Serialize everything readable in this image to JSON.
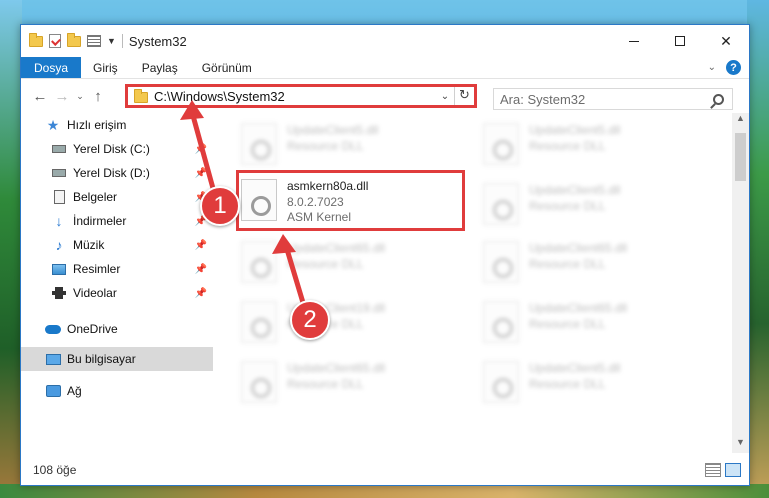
{
  "window": {
    "title": "System32",
    "controls": {
      "minimize": "—",
      "maximize": "",
      "close": "✕"
    }
  },
  "ribbon": {
    "tabs": [
      "Dosya",
      "Giriş",
      "Paylaş",
      "Görünüm"
    ],
    "help": "?"
  },
  "nav": {
    "back": "←",
    "forward": "→",
    "recent": "⌄",
    "up": "↑",
    "address": "C:\\Windows\\System32",
    "dropdown": "⌄",
    "refresh": "↻",
    "search_placeholder": "Ara: System32"
  },
  "sidebar": {
    "items": [
      {
        "label": "Hızlı erişim",
        "icon": "star-icon",
        "pinned": false
      },
      {
        "label": "Yerel Disk (C:)",
        "icon": "disk-icon",
        "pinned": true
      },
      {
        "label": "Yerel Disk (D:)",
        "icon": "disk-icon",
        "pinned": true
      },
      {
        "label": "Belgeler",
        "icon": "document-icon",
        "pinned": true
      },
      {
        "label": "İndirmeler",
        "icon": "download-icon",
        "pinned": true
      },
      {
        "label": "Müzik",
        "icon": "music-icon",
        "pinned": true
      },
      {
        "label": "Resimler",
        "icon": "pictures-icon",
        "pinned": true
      },
      {
        "label": "Videolar",
        "icon": "videos-icon",
        "pinned": true
      },
      {
        "label": "OneDrive",
        "icon": "cloud-icon",
        "pinned": false
      },
      {
        "label": "Bu bilgisayar",
        "icon": "computer-icon",
        "pinned": false,
        "selected": true
      },
      {
        "label": "Ağ",
        "icon": "network-icon",
        "pinned": false
      }
    ]
  },
  "files": {
    "highlighted": {
      "name": "asmkern80a.dll",
      "version": "8.0.2.7023",
      "description": "ASM Kernel"
    },
    "blurred_left": [
      {
        "name": "UpdateClient5.dll",
        "desc": "Resource DLL"
      },
      {
        "name": "UpdateClient65.dll",
        "desc": "Resource DLL"
      },
      {
        "name": "UpdateClient19.dll",
        "desc": "Resource DLL"
      },
      {
        "name": "UpdateClient65.dll",
        "desc": "Resource DLL"
      }
    ],
    "blurred_right": [
      {
        "name": "UpdateClient5.dll",
        "desc": "Resource DLL"
      },
      {
        "name": "UpdateClient5.dll",
        "desc": "Resource DLL"
      },
      {
        "name": "UpdateClient65.dll",
        "desc": "Resource DLL"
      },
      {
        "name": "UpdateClient65.dll",
        "desc": "Resource DLL"
      },
      {
        "name": "UpdateClient5.dll",
        "desc": "Resource DLL"
      }
    ]
  },
  "status": {
    "count": "108 öğe"
  },
  "callouts": {
    "one": "1",
    "two": "2"
  },
  "colors": {
    "accent": "#1979ca",
    "callout": "#e03c3c"
  }
}
